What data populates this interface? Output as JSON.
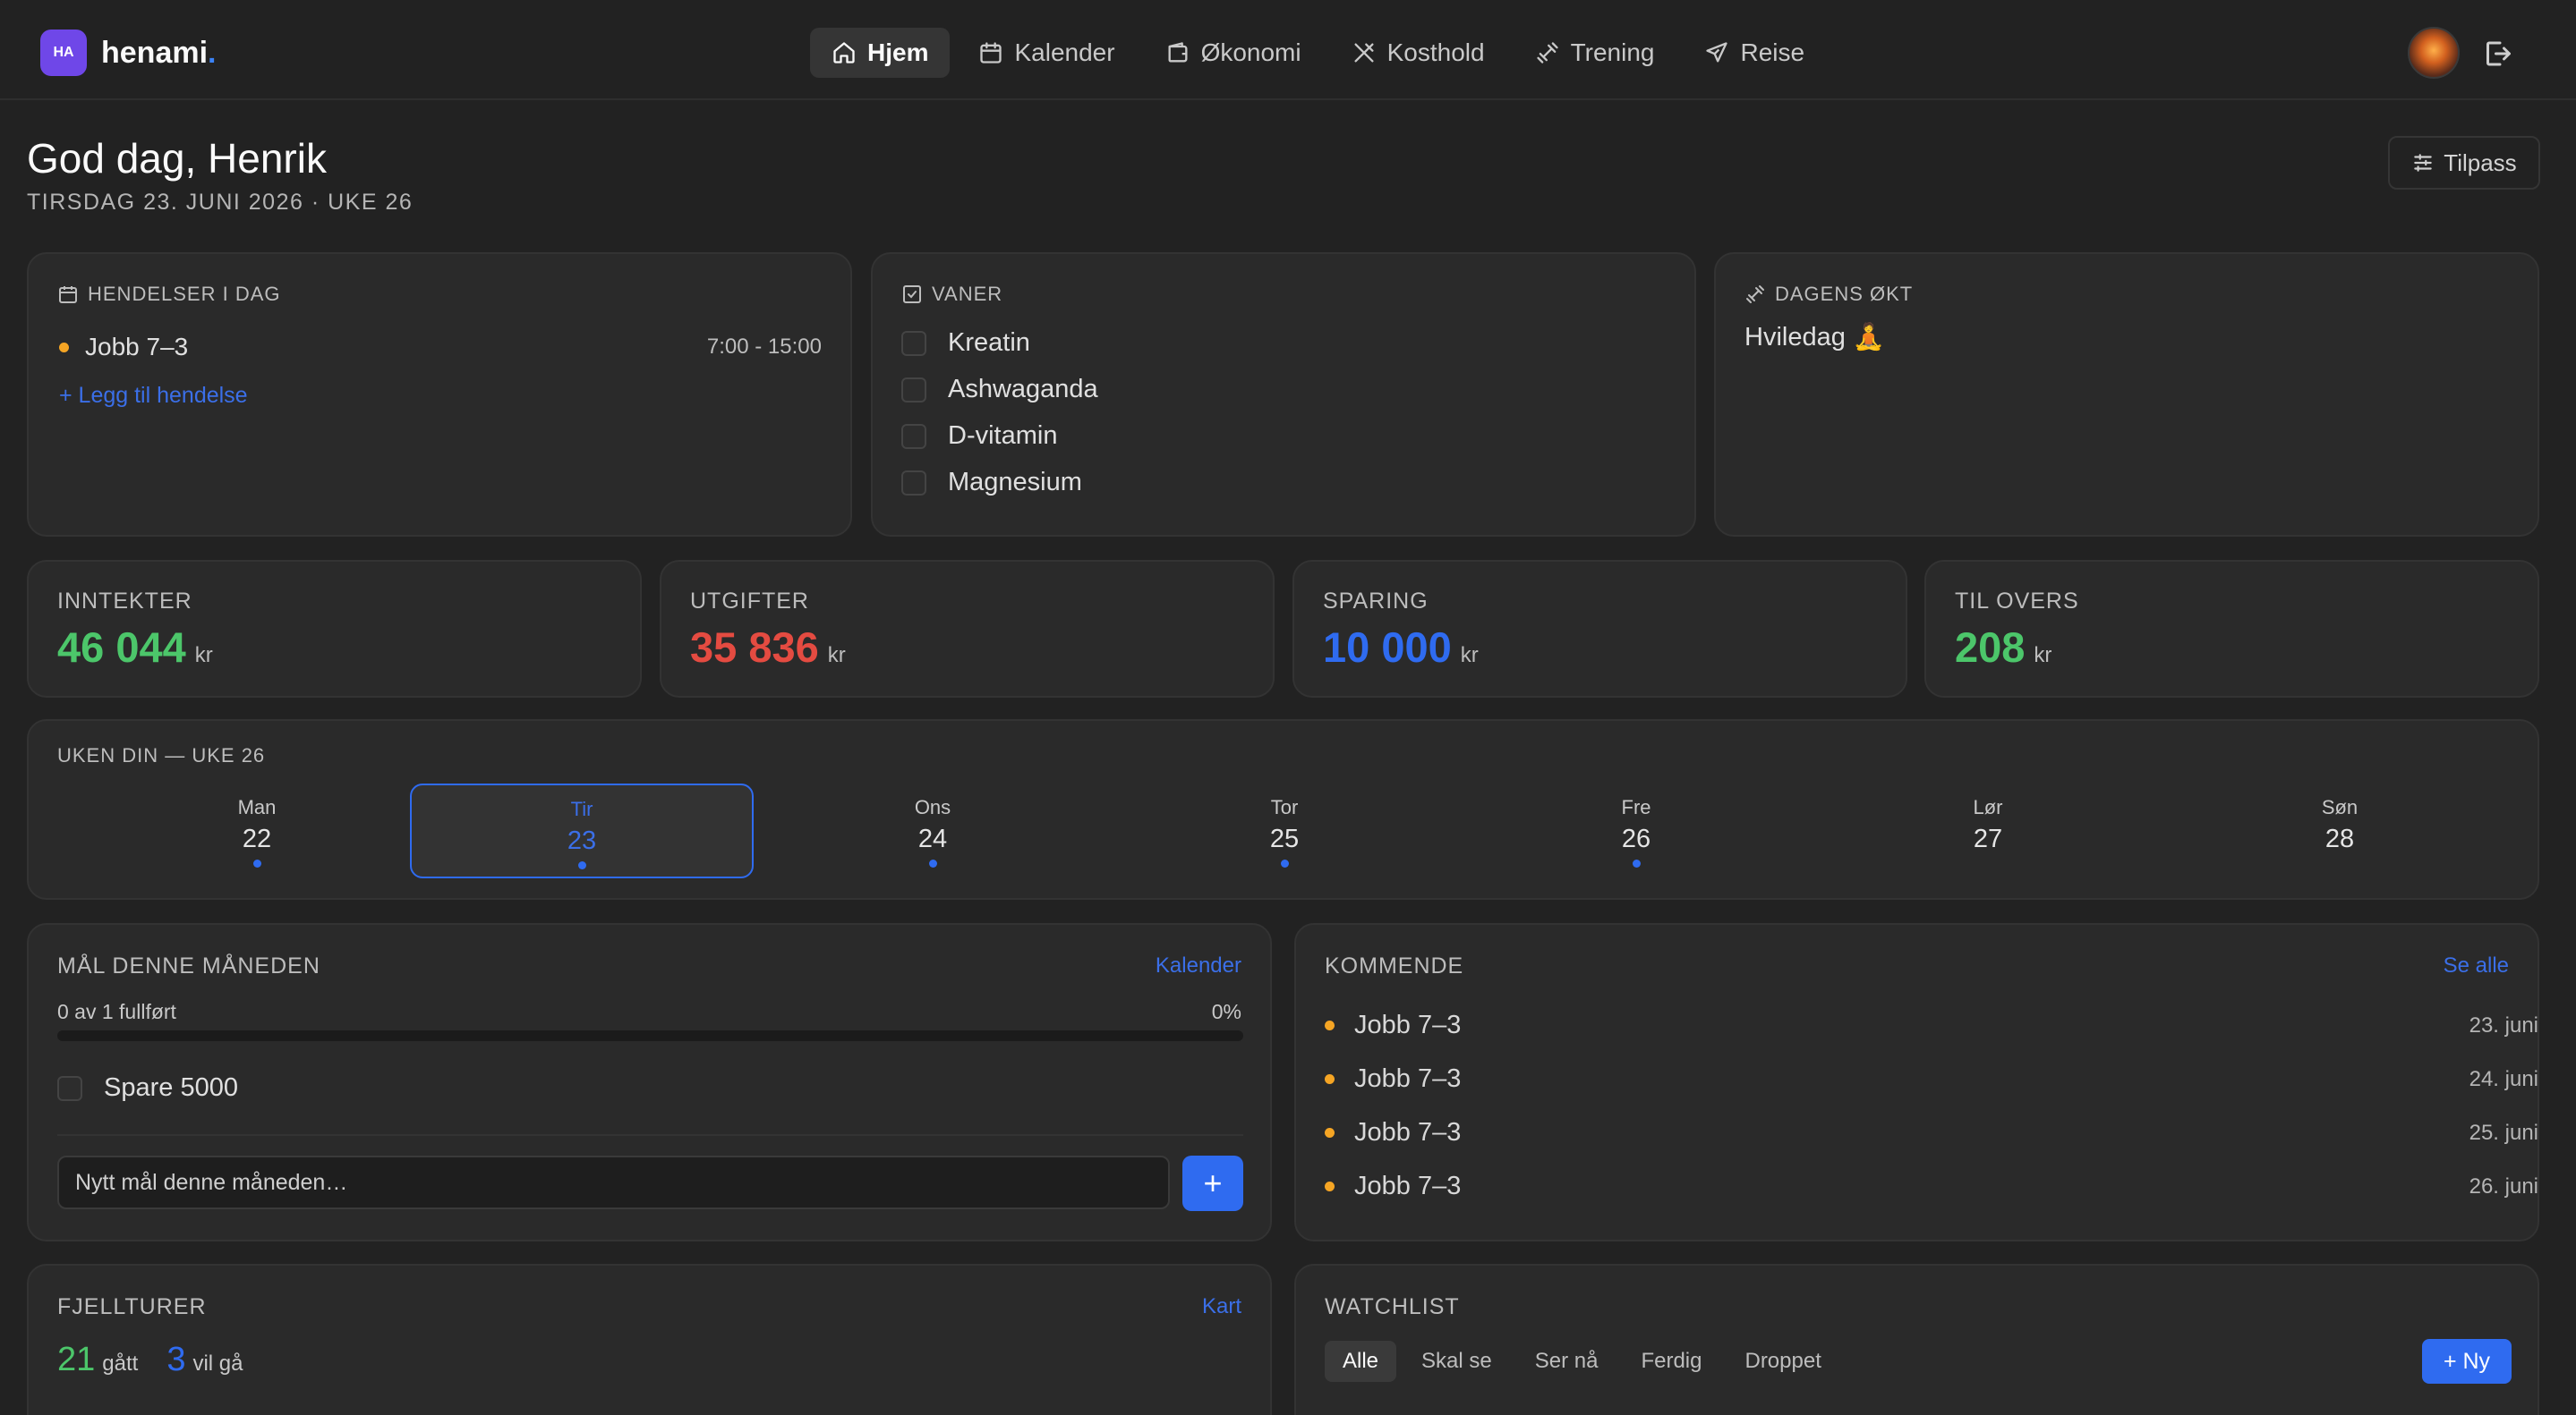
{
  "app": {
    "logo_badge": "HA",
    "logo_name": "henami",
    "logo_dot": "."
  },
  "nav": [
    {
      "label": "Hjem",
      "icon": "home-icon",
      "active": true
    },
    {
      "label": "Kalender",
      "icon": "calendar-icon"
    },
    {
      "label": "Økonomi",
      "icon": "wallet-icon"
    },
    {
      "label": "Kosthold",
      "icon": "utensils-icon"
    },
    {
      "label": "Trening",
      "icon": "dumbbell-icon"
    },
    {
      "label": "Reise",
      "icon": "plane-icon"
    }
  ],
  "header": {
    "greeting": "God dag, Henrik",
    "date": "TIRSDAG 23. JUNI 2026 · UKE 26",
    "customize_label": "Tilpass"
  },
  "events": {
    "title": "HENDELSER I DAG",
    "items": [
      {
        "name": "Jobb 7–3",
        "time": "7:00 - 15:00"
      }
    ],
    "add_label": "+ Legg til hendelse"
  },
  "habits": {
    "title": "VANER",
    "items": [
      "Kreatin",
      "Ashwaganda",
      "D-vitamin",
      "Magnesium"
    ]
  },
  "workout": {
    "title": "DAGENS ØKT",
    "text": "Hviledag 🧘"
  },
  "finance": [
    {
      "label": "INNTEKTER",
      "value": "46 044",
      "unit": "kr",
      "color": "#4cc66a"
    },
    {
      "label": "UTGIFTER",
      "value": "35 836",
      "unit": "kr",
      "color": "#e44b41"
    },
    {
      "label": "SPARING",
      "value": "10 000",
      "unit": "kr",
      "color": "#2f6bf0"
    },
    {
      "label": "TIL OVERS",
      "value": "208",
      "unit": "kr",
      "color": "#4cc66a"
    }
  ],
  "week": {
    "title": "UKEN DIN — UKE 26",
    "days": [
      {
        "name": "Man",
        "num": "22",
        "has_event": true
      },
      {
        "name": "Tir",
        "num": "23",
        "has_event": true,
        "selected": true
      },
      {
        "name": "Ons",
        "num": "24",
        "has_event": true
      },
      {
        "name": "Tor",
        "num": "25",
        "has_event": true
      },
      {
        "name": "Fre",
        "num": "26",
        "has_event": true
      },
      {
        "name": "Lør",
        "num": "27",
        "has_event": false
      },
      {
        "name": "Søn",
        "num": "28",
        "has_event": false
      }
    ]
  },
  "goals": {
    "title": "MÅL DENNE MÅNEDEN",
    "link": "Kalender",
    "progress_text": "0 av 1 fullført",
    "progress_percent_label": "0%",
    "progress_fraction": 0,
    "items": [
      "Spare 5000"
    ],
    "input_placeholder": "Nytt mål denne måneden…",
    "add_button": "+"
  },
  "upcoming": {
    "title": "KOMMENDE",
    "link": "Se alle",
    "items": [
      {
        "name": "Jobb 7–3",
        "date": "23. juni"
      },
      {
        "name": "Jobb 7–3",
        "date": "24. juni"
      },
      {
        "name": "Jobb 7–3",
        "date": "25. juni"
      },
      {
        "name": "Jobb 7–3",
        "date": "26. juni"
      }
    ]
  },
  "hikes": {
    "title": "FJELLTURER",
    "link": "Kart",
    "done_count": "21",
    "done_label": "gått",
    "want_count": "3",
    "want_label": "vil gå"
  },
  "watchlist": {
    "title": "WATCHLIST",
    "tabs": [
      "Alle",
      "Skal se",
      "Ser nå",
      "Ferdig",
      "Droppet"
    ],
    "active_tab": "Alle",
    "new_button": "+ Ny"
  }
}
